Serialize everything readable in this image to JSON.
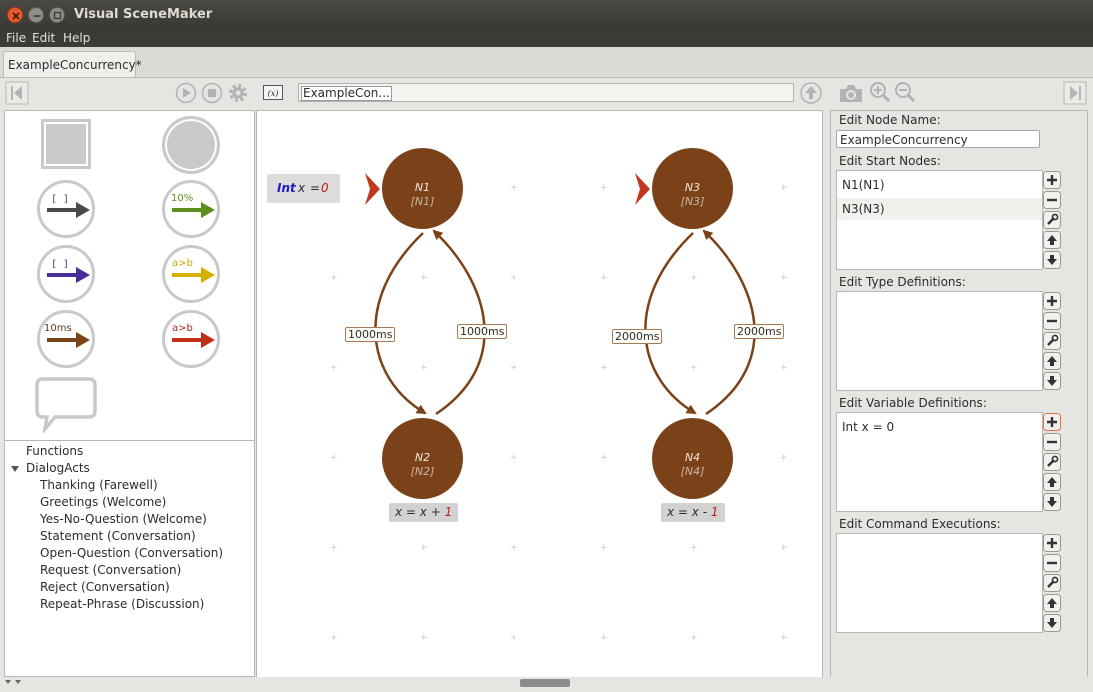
{
  "window": {
    "title": "Visual SceneMaker"
  },
  "menu": [
    "File",
    "Edit",
    "Help"
  ],
  "tab": {
    "label": "ExampleConcurrency*"
  },
  "toolbar": {
    "path_value": "ExampleCon..."
  },
  "palette": {
    "labels": {
      "percent": "10%",
      "cond1": "a>b",
      "timeout": "10ms",
      "cond2": "a>b"
    },
    "colors": {
      "epsilon": "#4a4a4a",
      "probability": "#5e8f1e",
      "interrupt": "#4a2d96",
      "conditional": "#d3b000",
      "timeout": "#7a4419",
      "forced": "#c03018"
    }
  },
  "tree": {
    "functions_label": "Functions",
    "group_label": "DialogActs",
    "items": [
      "Thanking (Farewell)",
      "Greetings (Welcome)",
      "Yes-No-Question (Welcome)",
      "Statement (Conversation)",
      "Open-Question (Conversation)",
      "Request (Conversation)",
      "Reject (Conversation)",
      "Repeat-Phrase (Discussion)"
    ]
  },
  "canvas": {
    "var_badge": {
      "type": "Int",
      "name": "x",
      "op": "=",
      "value": "0"
    },
    "nodes": [
      {
        "name": "N1",
        "id": "[N1]"
      },
      {
        "name": "N2",
        "id": "[N2]"
      },
      {
        "name": "N3",
        "id": "[N3]"
      },
      {
        "name": "N4",
        "id": "[N4]"
      }
    ],
    "edges": [
      "1000ms",
      "1000ms",
      "2000ms",
      "2000ms"
    ],
    "commands": [
      {
        "lhs": "x = x + ",
        "rhs": "1"
      },
      {
        "lhs": "x = x - ",
        "rhs": "1"
      }
    ]
  },
  "panel": {
    "node_name_label": "Edit Node Name:",
    "node_name_value": "ExampleConcurrency",
    "start_nodes_label": "Edit Start Nodes:",
    "start_nodes": [
      "N1(N1)",
      "N3(N3)"
    ],
    "type_defs_label": "Edit Type Definitions:",
    "var_defs_label": "Edit Variable Definitions:",
    "var_defs": [
      "Int x = 0"
    ],
    "cmd_exec_label": "Edit Command Executions:"
  }
}
